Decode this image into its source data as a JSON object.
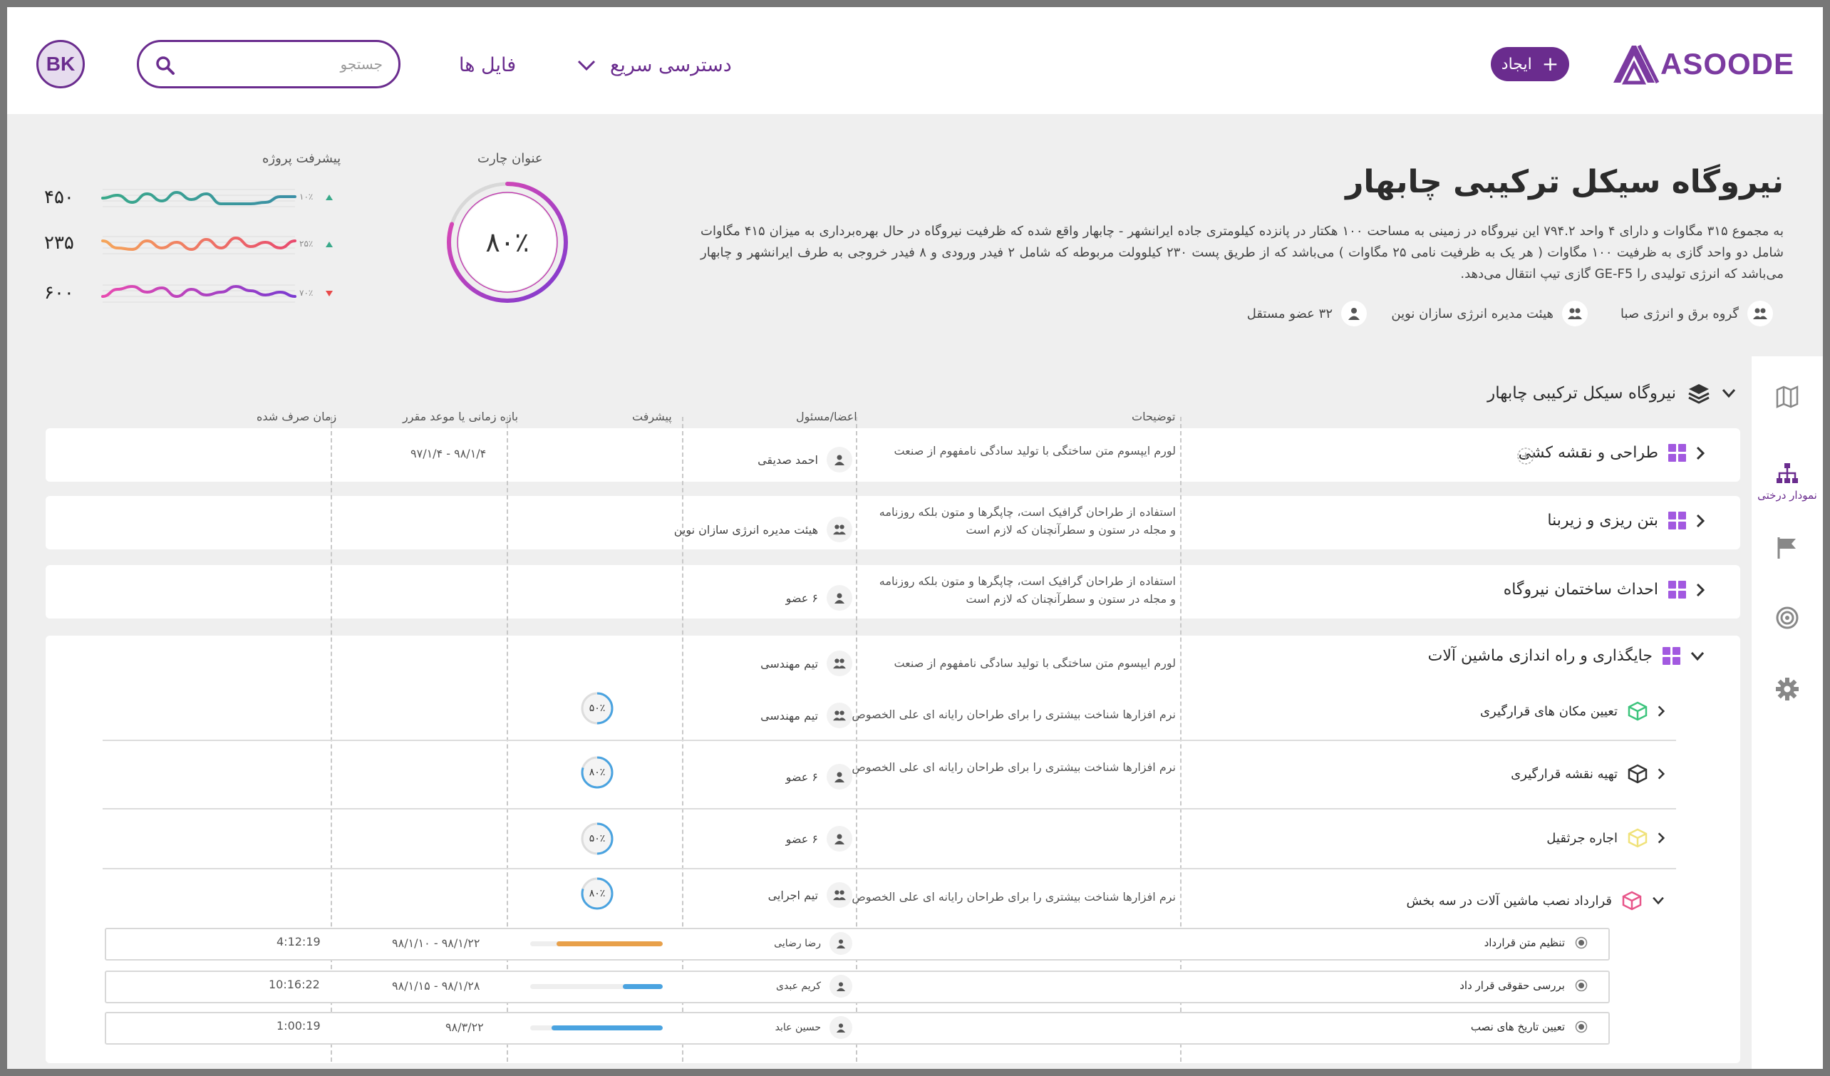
{
  "header": {
    "logo_text": "ASOODE",
    "create_label": "ایجاد",
    "quick_access_label": "دسترسی سریع",
    "files_label": "فایل ها",
    "search_placeholder": "جستجو",
    "avatar_initials": "BK"
  },
  "project": {
    "title": "نیروگاه سیکل ترکیبی چابهار",
    "description": "به مجموع ۳۱۵ مگاوات و دارای ۴ واحد ۷۹۴.۲ این نیروگاه در زمینی به مساحت ۱۰۰ هکتار در پانزده کیلومتری جاده ایرانشهر - چابهار واقع شده که ظرفیت نیروگاه در حال بهره‌برداری به میزان ۴۱۵ مگاوات شامل دو واحد گازی به ظرفیت ۱۰۰ مگاوات ( هر یک به ظرفیت نامی ۲۵ مگاوات ) می‌باشد که از طریق پست ۲۳۰ کیلوولت مربوطه که شامل ۲ فیدر ورودی و ۸ فیدر خروجی به طرف ایرانشهر و چابهار می‌باشد که انرژی تولیدی را GE-F5 گازی تیپ انتقال می‌دهد.",
    "tags": [
      {
        "label": "گروه برق و انرژی صبا",
        "icon": "users-icon"
      },
      {
        "label": "هیئت مدیره انرژی سازان نوین",
        "icon": "users-icon"
      },
      {
        "label": "۳۲ عضو مستقل",
        "icon": "user-tie-icon"
      }
    ]
  },
  "donut": {
    "title": "عنوان چارت",
    "value_label": "۸۰٪",
    "value": 80
  },
  "progress_chart": {
    "title": "پیشرفت پروژه",
    "series": [
      {
        "value_label": "۴۵۰",
        "pct_label": "۱۰٪",
        "trend": "up",
        "trend_color": "#3aa98a",
        "color_start": "#3aa98a",
        "color_end": "#3b8fa6"
      },
      {
        "value_label": "۲۳۵",
        "pct_label": "۲۵٪",
        "trend": "up",
        "trend_color": "#3aa98a",
        "color_start": "#f5a55a",
        "color_end": "#e84a6e"
      },
      {
        "value_label": "۶۰۰",
        "pct_label": "۷۰٪",
        "trend": "down",
        "trend_color": "#e84a4a",
        "color_start": "#e84ab0",
        "color_end": "#7b3ad0"
      }
    ]
  },
  "sidebar": {
    "items": [
      {
        "icon": "map-icon",
        "label": ""
      },
      {
        "icon": "org-tree-icon",
        "label": "نمودار درختی"
      },
      {
        "icon": "flag-icon",
        "label": ""
      },
      {
        "icon": "target-icon",
        "label": ""
      },
      {
        "icon": "gear-icon",
        "label": ""
      }
    ]
  },
  "tree": {
    "root_title": "نیروگاه سیکل ترکیبی چابهار",
    "columns": {
      "description": "توضیحات",
      "members": "اعضا/مسئول",
      "progress": "پیشرفت",
      "period": "بازه زمانی یا موعد مقرر",
      "time_spent": "زمان صرف شده"
    },
    "rows": [
      {
        "title": "طراحی و نقشه کشی",
        "description": "لورم ایپسوم متن ساختگی با تولید سادگی نامفهوم از صنعت",
        "member": "احمد صدیقی",
        "period": "۹۸/۱/۴ - ۹۷/۱/۴"
      },
      {
        "title": "بتن ریزی و زیربنا",
        "description": "استفاده از طراحان گرافیک است، چاپگرها و متون بلکه روزنامه و مجله در ستون و سطرآنچنان که لازم است",
        "member": "هیئت مدیره انرژی سازان نوین"
      },
      {
        "title": "احداث ساختمان نیروگاه",
        "description": "استفاده از طراحان گرافیک است، چاپگرها و متون بلکه روزنامه و مجله در ستون و سطرآنچنان که لازم است",
        "member": "۶ عضو"
      },
      {
        "title": "جایگذاری و راه اندازی ماشین آلات",
        "description": "لورم ایپسوم متن ساختگی با تولید سادگی نامفهوم از صنعت",
        "member": "تیم مهندسی"
      }
    ],
    "subrows": [
      {
        "title": "تعیین مکان های قرارگیری",
        "description": "نرم افزارها شناخت بیشتری را برای طراحان رایانه ای علی الخصوص",
        "member": "تیم مهندسی",
        "progress_label": "۵۰٪",
        "progress": 50,
        "cube_color": "#3cc47c"
      },
      {
        "title": "تهیه نقشه قرارگیری",
        "description": "نرم افزارها شناخت بیشتری را برای طراحان رایانه ای علی الخصوص",
        "member": "۶ عضو",
        "progress_label": "۸۰٪",
        "progress": 80,
        "cube_color": "#333333"
      },
      {
        "title": "اجاره جرثقیل",
        "description": "",
        "member": "۶ عضو",
        "progress_label": "۵۰٪",
        "progress": 50,
        "cube_color": "#f0e27a"
      },
      {
        "title": "قرارداد نصب ماشین آلات در سه بخش",
        "description": "نرم افزارها شناخت بیشتری را برای طراحان رایانه ای علی الخصوص",
        "member": "تیم اجرایی",
        "progress_label": "۸۰٪",
        "progress": 80,
        "cube_color": "#e8568a"
      }
    ],
    "leaves": [
      {
        "title": "تنظیم متن قرارداد",
        "member": "رضا رضایی",
        "period": "۹۸/۱/۲۲ - ۹۸/۱/۱۰",
        "time": "4:12:19",
        "progress": 0.8,
        "bar_color": "#e8a04a"
      },
      {
        "title": "بررسی حقوقی قرار داد",
        "member": "کریم عبدی",
        "period": "۹۸/۱/۲۸ - ۹۸/۱/۱۵",
        "time": "10:16:22",
        "progress": 0.3,
        "bar_color": "#4aa3e0"
      },
      {
        "title": "تعیین تاریخ های نصب",
        "member": "حسین عابد",
        "period": "۹۸/۳/۲۲",
        "time": "1:00:19",
        "progress": 0.84,
        "bar_color": "#4aa3e0"
      }
    ]
  }
}
